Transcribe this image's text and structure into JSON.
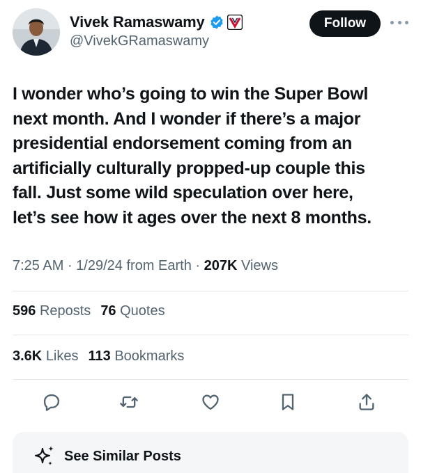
{
  "author": {
    "name": "Vivek Ramaswamy",
    "handle": "@VivekGRamaswamy",
    "verified": true,
    "affiliation_badge": "V"
  },
  "header": {
    "follow_label": "Follow",
    "more_icon": "ellipsis-icon"
  },
  "tweet": {
    "text": "I wonder who’s going to win the Super Bowl\nnext month. And I wonder if there’s a major\npresidential endorsement coming from an\nartificially culturally propped-up couple this\nfall. Just some wild speculation over here,\nlet’s see how it ages over the next 8 months."
  },
  "meta": {
    "time": "7:25 AM",
    "sep1": " · ",
    "date": "1/29/24",
    "source": " from Earth",
    "sep2": " · ",
    "views_count": "207K",
    "views_label": " Views"
  },
  "stats": {
    "reposts_count": "596",
    "reposts_label": "Reposts",
    "quotes_count": "76",
    "quotes_label": "Quotes",
    "likes_count": "3.6K",
    "likes_label": "Likes",
    "bookmarks_count": "113",
    "bookmarks_label": "Bookmarks"
  },
  "actions": [
    "reply-icon",
    "repost-icon",
    "like-icon",
    "bookmark-icon",
    "share-icon"
  ],
  "similar": {
    "label": "See Similar Posts",
    "icon": "sparkle-icon"
  },
  "colors": {
    "text": "#0f1419",
    "secondary": "#536471",
    "verified_blue": "#1d9bf0",
    "divider": "#e3e7ea",
    "button_bg": "#0f1419"
  }
}
